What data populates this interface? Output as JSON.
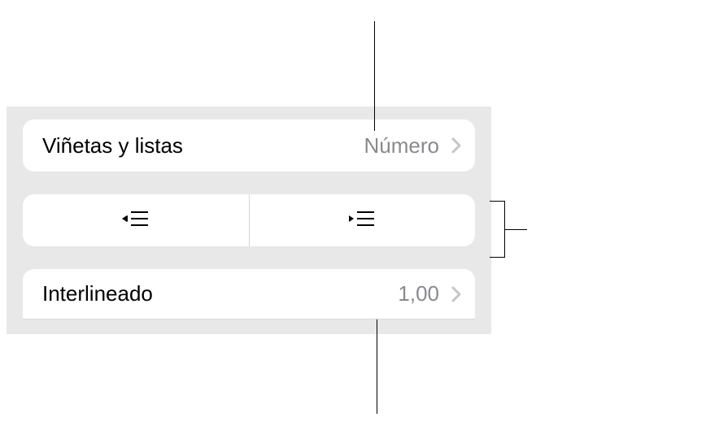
{
  "rows": {
    "bullets": {
      "label": "Viñetas y listas",
      "value": "Número"
    },
    "spacing": {
      "label": "Interlineado",
      "value": "1,00"
    }
  }
}
